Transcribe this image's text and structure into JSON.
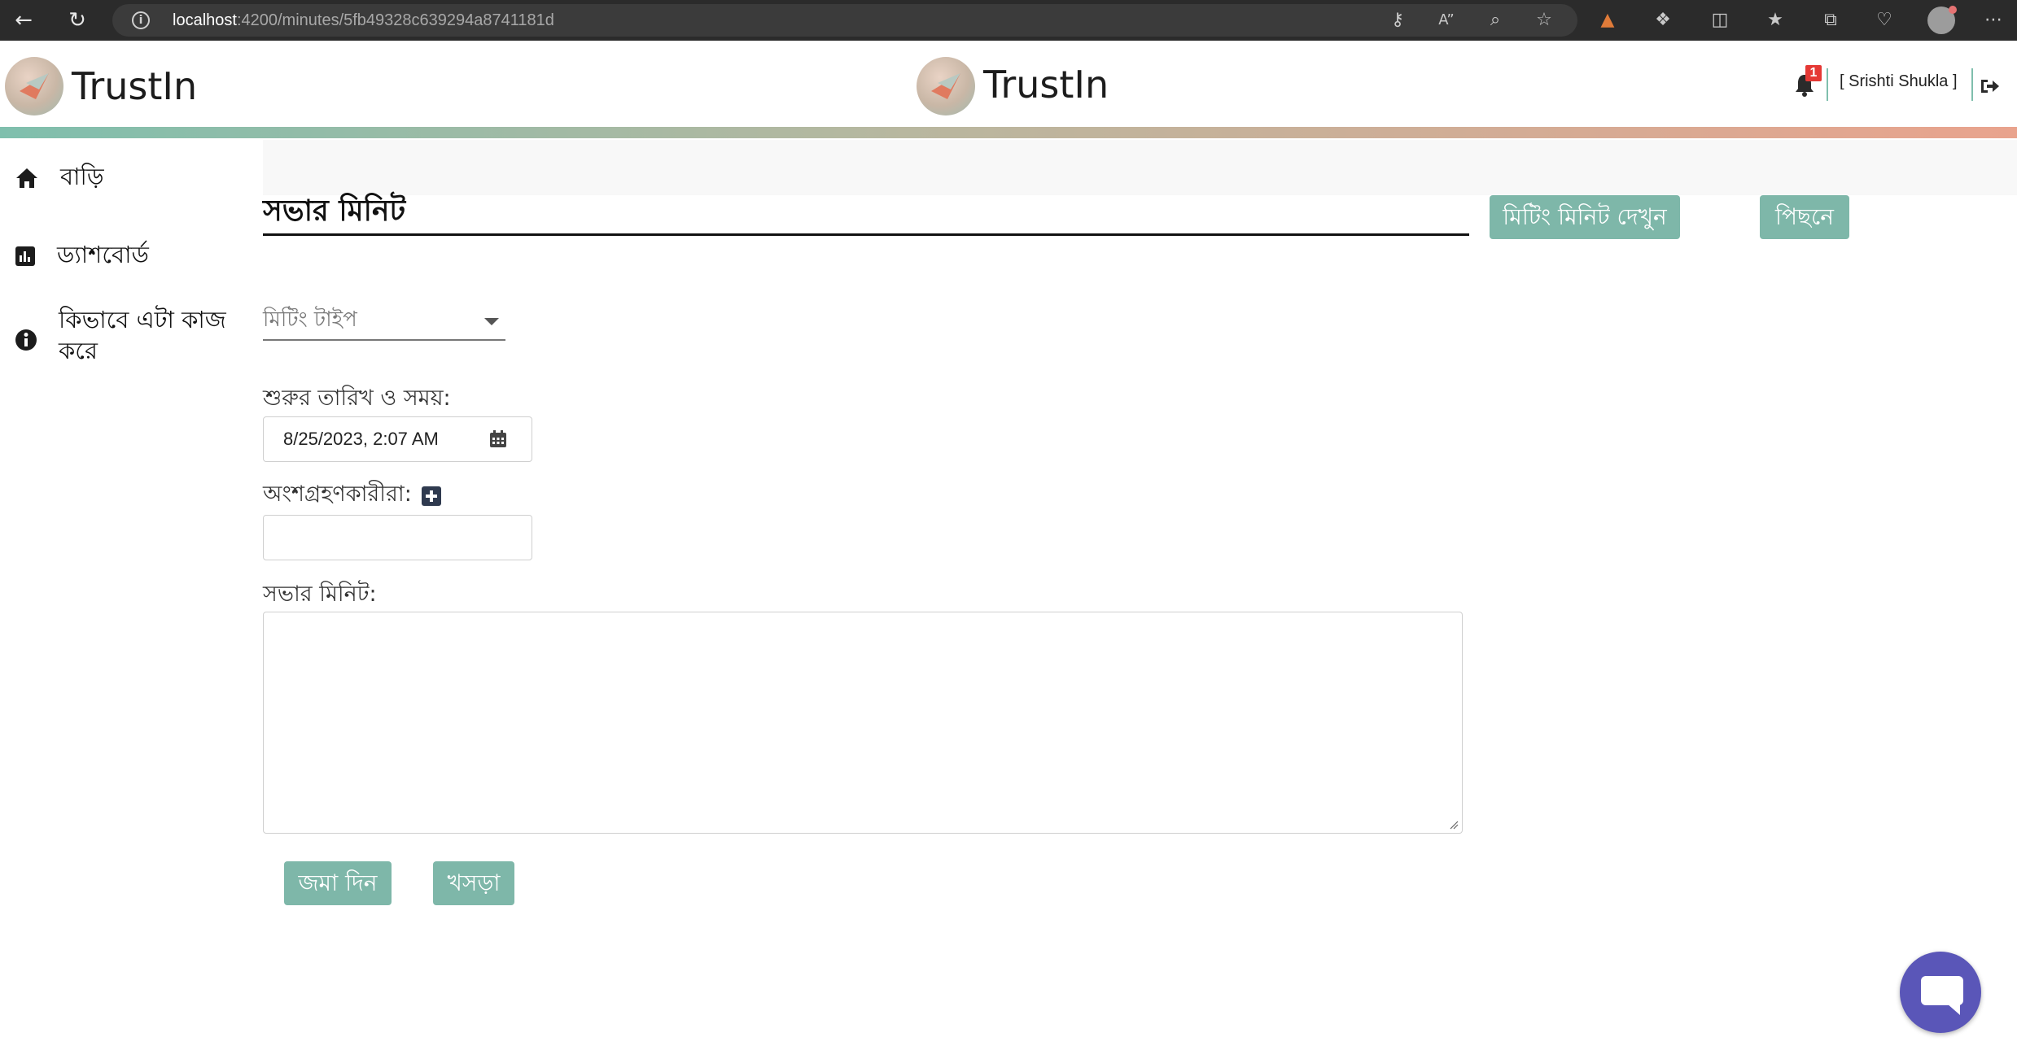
{
  "browser": {
    "url_host": "localhost",
    "url_path": ":4200/minutes/5fb49328c639294a8741181d"
  },
  "header": {
    "brand_left": "TrustIn",
    "brand_center": "TrustIn",
    "notification_count": "1",
    "user_label": "[ Srishti Shukla ]"
  },
  "sidebar": {
    "items": [
      {
        "label": "বাড়ি",
        "icon": "home-icon"
      },
      {
        "label": "ড্যাশবোর্ড",
        "icon": "chart-icon"
      },
      {
        "label": "কিভাবে এটা কাজ করে",
        "icon": "info-icon"
      }
    ]
  },
  "main": {
    "title": "সভার মিনিট",
    "view_minutes_button": "মিটিং মিনিট দেখুন",
    "back_button": "পিছনে",
    "meeting_type_placeholder": "মিটিং টাইপ",
    "start_label": "শুরুর তারিখ ও সময়:",
    "start_value": "8/25/2023, 2:07 AM",
    "participants_label": "অংশগ্রহণকারীরা:",
    "participants_value": "",
    "minutes_label": "সভার মিনিট:",
    "minutes_value": "",
    "submit_button": "জমা দিন",
    "draft_button": "খসড়া"
  },
  "colors": {
    "accent": "#7eb7a9",
    "chat": "#5a56b8",
    "badge": "#e53935"
  }
}
